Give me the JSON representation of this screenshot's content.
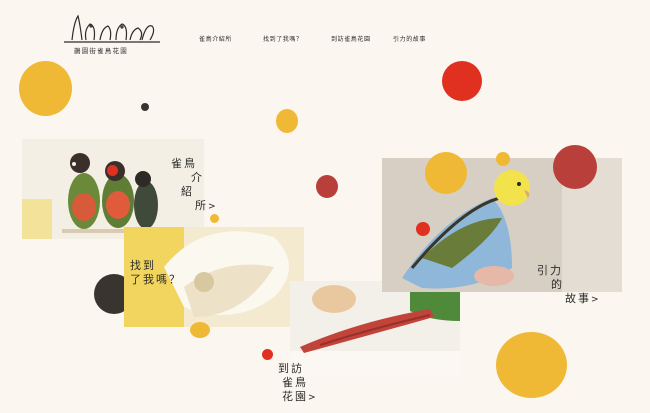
{
  "brand": {
    "logo_text": "鵲園街雀鳥花園"
  },
  "nav": {
    "items": [
      {
        "label": "雀鳥介紹所"
      },
      {
        "label": "找到了我嗎？"
      },
      {
        "label": "到訪雀鳥花園"
      },
      {
        "label": "引力的故事"
      }
    ]
  },
  "cards": {
    "intro": {
      "line1": "雀鳥",
      "line2": "介",
      "line3": "紹",
      "line4": "所",
      "arrow": ">"
    },
    "find": {
      "line1": "找到",
      "line2": "了我嗎？"
    },
    "visit": {
      "line1": "到訪",
      "line2": "雀鳥",
      "line3": "花園",
      "arrow": ">"
    },
    "story": {
      "line1": "引力",
      "line2": "的",
      "line3": "故事",
      "arrow": ">"
    }
  },
  "colors": {
    "background": "#fbf6ef",
    "yellow": "#f0b935",
    "red": "#e03020",
    "brick": "#b9403a",
    "dark": "#3a3430"
  }
}
